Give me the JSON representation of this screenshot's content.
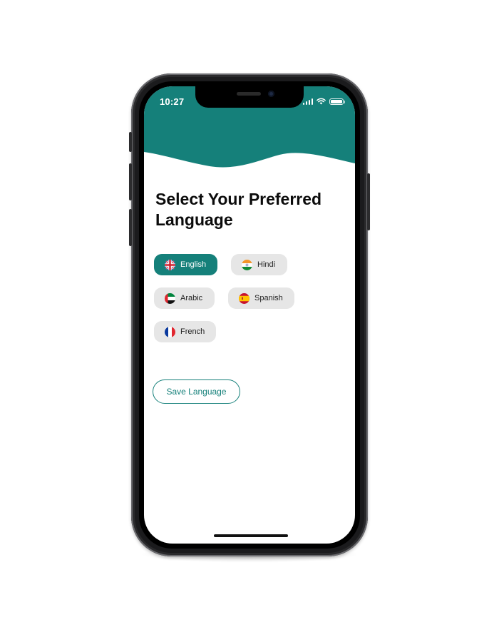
{
  "status_bar": {
    "time": "10:27"
  },
  "header": {
    "color": "#15807a"
  },
  "title": "Select Your Preferred Language",
  "languages": [
    {
      "label": "English",
      "flag": "uk-flag-icon",
      "selected": true
    },
    {
      "label": "Hindi",
      "flag": "india-flag-icon",
      "selected": false
    },
    {
      "label": "Arabic",
      "flag": "uae-flag-icon",
      "selected": false
    },
    {
      "label": "Spanish",
      "flag": "spain-flag-icon",
      "selected": false
    },
    {
      "label": "French",
      "flag": "france-flag-icon",
      "selected": false
    }
  ],
  "save_button": {
    "label": "Save Language"
  },
  "colors": {
    "accent": "#15807a",
    "chip_bg": "#e6e6e6",
    "title_text": "#0b0b0b"
  }
}
